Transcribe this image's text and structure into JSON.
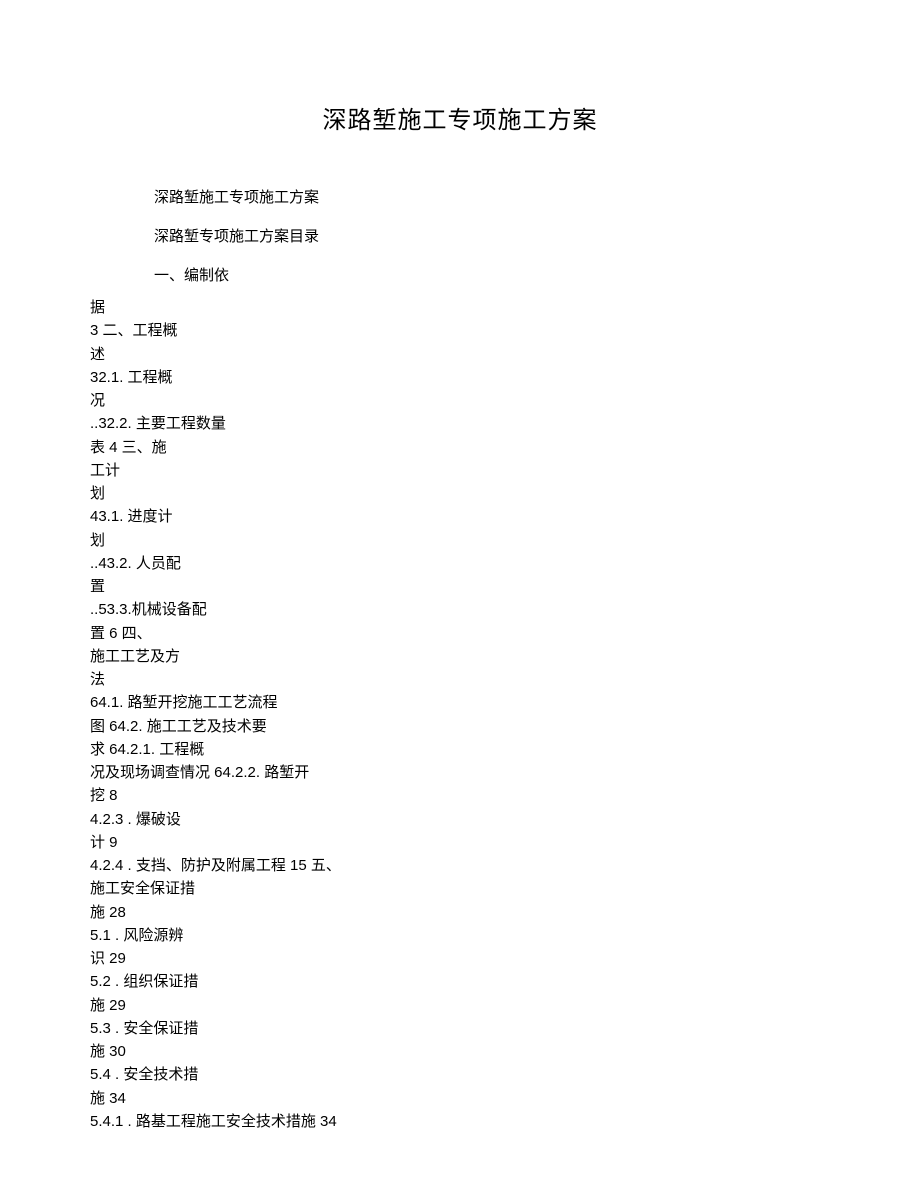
{
  "title": "深路堑施工专项施工方案",
  "intro1": "深路堑施工专项施工方案",
  "intro2": "深路堑专项施工方案目录",
  "toc_first": "一、编制依",
  "toc_lines": [
    "据",
    "3 二、工程概",
    "述",
    "32.1.  工程概",
    "况",
    "..32.2.  主要工程数量",
    "表 4 三、施",
    "工计",
    "划",
    "43.1.  进度计",
    "划",
    "..43.2.  人员配",
    "置",
    "..53.3.机械设备配",
    "置 6 四、",
    "施工工艺及方",
    "法",
    "64.1.  路堑开挖施工工艺流程",
    "图 64.2.  施工工艺及技术要",
    "求 64.2.1.  工程概",
    "况及现场调查情况 64.2.2.  路堑开",
    "挖 8",
    "4.2.3  .  爆破设",
    "计 9",
    "4.2.4  .  支挡、防护及附属工程 15 五、",
    "施工安全保证措",
    "施 28",
    "5.1  .  风险源辨",
    "识 29",
    "5.2  .  组织保证措",
    "施 29",
    "5.3  .  安全保证措",
    "施 30",
    "5.4  .  安全技术措",
    "施 34",
    "5.4.1  .  路基工程施工安全技术措施 34"
  ]
}
